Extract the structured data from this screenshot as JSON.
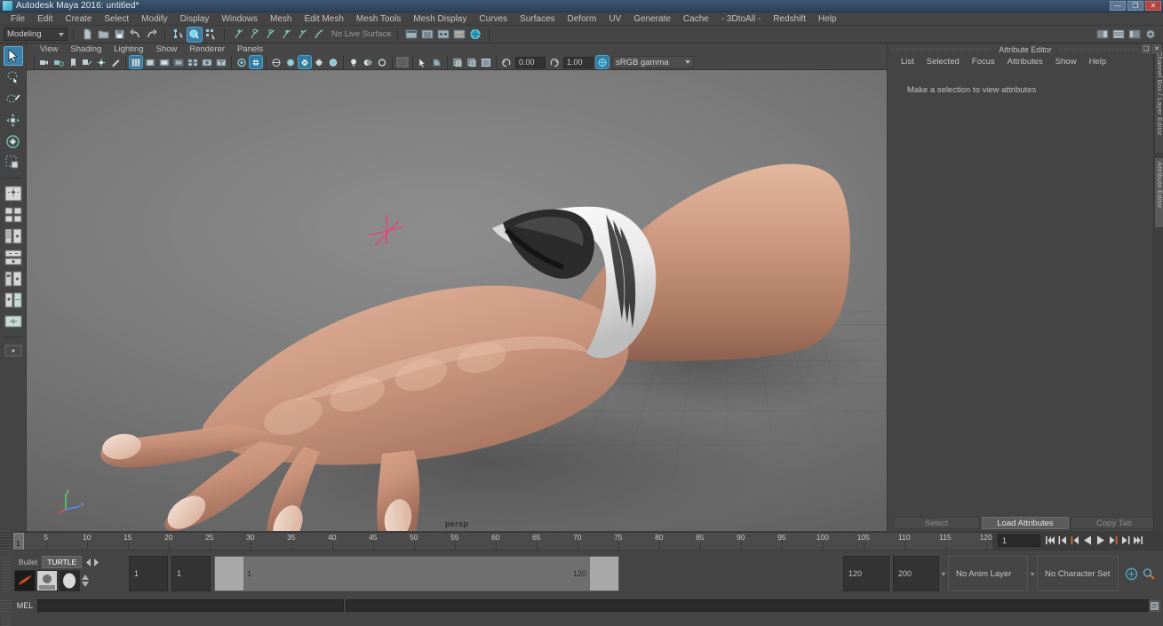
{
  "window": {
    "title": "Autodesk Maya 2016: untitled*",
    "app_icon": "maya-icon",
    "buttons": [
      {
        "name": "minimize-button",
        "glyph": "—"
      },
      {
        "name": "maximize-button",
        "glyph": "❐"
      },
      {
        "name": "close-button",
        "glyph": "✕"
      }
    ]
  },
  "menubar": {
    "items": [
      "File",
      "Edit",
      "Create",
      "Select",
      "Modify",
      "Display",
      "Windows",
      "Mesh",
      "Edit Mesh",
      "Mesh Tools",
      "Mesh Display",
      "Curves",
      "Surfaces",
      "Deform",
      "UV",
      "Generate",
      "Cache",
      "- 3DtoAll -",
      "Redshift",
      "Help"
    ]
  },
  "statusline": {
    "menu_set": "Modeling",
    "live_surface": "No Live Surface",
    "icons": [
      "new-scene-icon",
      "open-scene-icon",
      "save-scene-icon",
      "undo-icon",
      "redo-icon",
      "select-by-hierarchy-icon",
      "select-by-object-icon",
      "select-by-component-icon",
      "snap-to-grid-icon",
      "snap-to-curve-icon",
      "snap-to-point-icon",
      "snap-to-projected-center-icon",
      "snap-to-view-plane-icon",
      "make-live-icon",
      "show-editor-icon",
      "show-outliner-icon",
      "show-hypergraph-icon",
      "show-graph-editor-icon",
      "render-view-icon"
    ],
    "right_icons": [
      "sidebar-toggle-1-icon",
      "sidebar-toggle-2-icon",
      "sidebar-toggle-3-icon",
      "sidebar-toggle-4-icon"
    ]
  },
  "lefttools": {
    "items": [
      {
        "name": "select-tool",
        "selected": true
      },
      {
        "name": "lasso-select-tool",
        "selected": false
      },
      {
        "name": "paint-select-tool",
        "selected": false
      },
      {
        "name": "move-tool",
        "selected": false
      },
      {
        "name": "rotate-tool",
        "selected": false
      },
      {
        "name": "scale-tool",
        "selected": false
      },
      {
        "name": "layout-single-perspective",
        "selected": false
      },
      {
        "name": "layout-four-view",
        "selected": false
      },
      {
        "name": "layout-outliner-persp",
        "selected": false
      },
      {
        "name": "layout-hypergraph-persp",
        "selected": false
      },
      {
        "name": "layout-persp-graph",
        "selected": false
      },
      {
        "name": "layout-hypershade-persp",
        "selected": false
      },
      {
        "name": "layout-relationship-editor",
        "selected": false
      },
      {
        "name": "layout-last-used",
        "selected": false
      }
    ]
  },
  "viewport": {
    "menu": [
      "View",
      "Shading",
      "Lighting",
      "Show",
      "Renderer",
      "Panels"
    ],
    "camera_label": "persp",
    "exposure": "0.00",
    "gamma": "1.00",
    "color_management": "sRGB gamma",
    "toolbar_icons": [
      "select-camera-icon",
      "camera-attributes-icon",
      "bookmark-icon",
      "image-plane-icon",
      "two-dimensional-pan-zoom-icon",
      "grease-pencil-icon",
      "grid-toggle-icon",
      "film-gate-icon",
      "resolution-gate-icon",
      "gate-mask-icon",
      "field-chart-icon",
      "safe-action-icon",
      "safe-title-icon",
      "xray-icon",
      "xray-joints-icon",
      "wireframe-icon",
      "smooth-shade-all-icon",
      "smooth-shade-textured-icon",
      "use-default-material-icon",
      "shaded-wireframe-icon",
      "lighting-all-icon",
      "shadows-icon",
      "ambient-occlusion-icon",
      "motion-blur-icon",
      "multisample-icon",
      "depth-of-field-icon",
      "isolate-select-icon",
      "viewport-snapshot-icon",
      "exposure-icon",
      "gamma-icon",
      "color-management-icon"
    ]
  },
  "attribute_editor": {
    "panel_title": "Attribute Editor",
    "menu": [
      "List",
      "Selected",
      "Focus",
      "Attributes",
      "Show",
      "Help"
    ],
    "message": "Make a selection to view attributes",
    "footer_buttons": [
      {
        "label": "Select",
        "active": false
      },
      {
        "label": "Load Attributes",
        "active": true
      },
      {
        "label": "Copy Tab",
        "active": false
      }
    ],
    "head_buttons": [
      "undock-icon",
      "close-icon"
    ],
    "side_tabs": [
      {
        "label": "Channel Box / Layer Editor",
        "active": false
      },
      {
        "label": "Attribute Editor",
        "active": true
      }
    ]
  },
  "timeslider": {
    "start": 1,
    "end": 120,
    "tick_step": 5,
    "labels": [
      5,
      10,
      15,
      20,
      25,
      30,
      35,
      40,
      45,
      50,
      55,
      60,
      65,
      70,
      75,
      80,
      85,
      90,
      95,
      100,
      105,
      110,
      115,
      120
    ],
    "current_frame": "1",
    "current_frame_field": "1",
    "playback_buttons": [
      "go-to-start-icon",
      "step-back-frame-icon",
      "step-back-key-icon",
      "play-backwards-icon",
      "play-forwards-icon",
      "step-forward-key-icon",
      "step-forward-frame-icon",
      "go-to-end-icon"
    ]
  },
  "rangeslider": {
    "shelf_tabs": [
      {
        "label": "Bullet",
        "active": false
      },
      {
        "label": "TURTLE",
        "active": true
      }
    ],
    "shelf_icons": [
      "turtle-render-icon",
      "turtle-bake-icon",
      "turtle-uv-icon"
    ],
    "anim_start": "1",
    "range_start": "1",
    "bar_start_label": "1",
    "bar_end_label": "120",
    "range_end": "120",
    "anim_end": "200",
    "anim_layer": "No Anim Layer",
    "character_set": "No Character Set",
    "right_icons": [
      "auto-keyframe-icon",
      "animation-preferences-icon"
    ]
  },
  "commandline": {
    "language": "MEL",
    "input_value": "",
    "output_value": "",
    "help_icon": "script-editor-icon"
  }
}
